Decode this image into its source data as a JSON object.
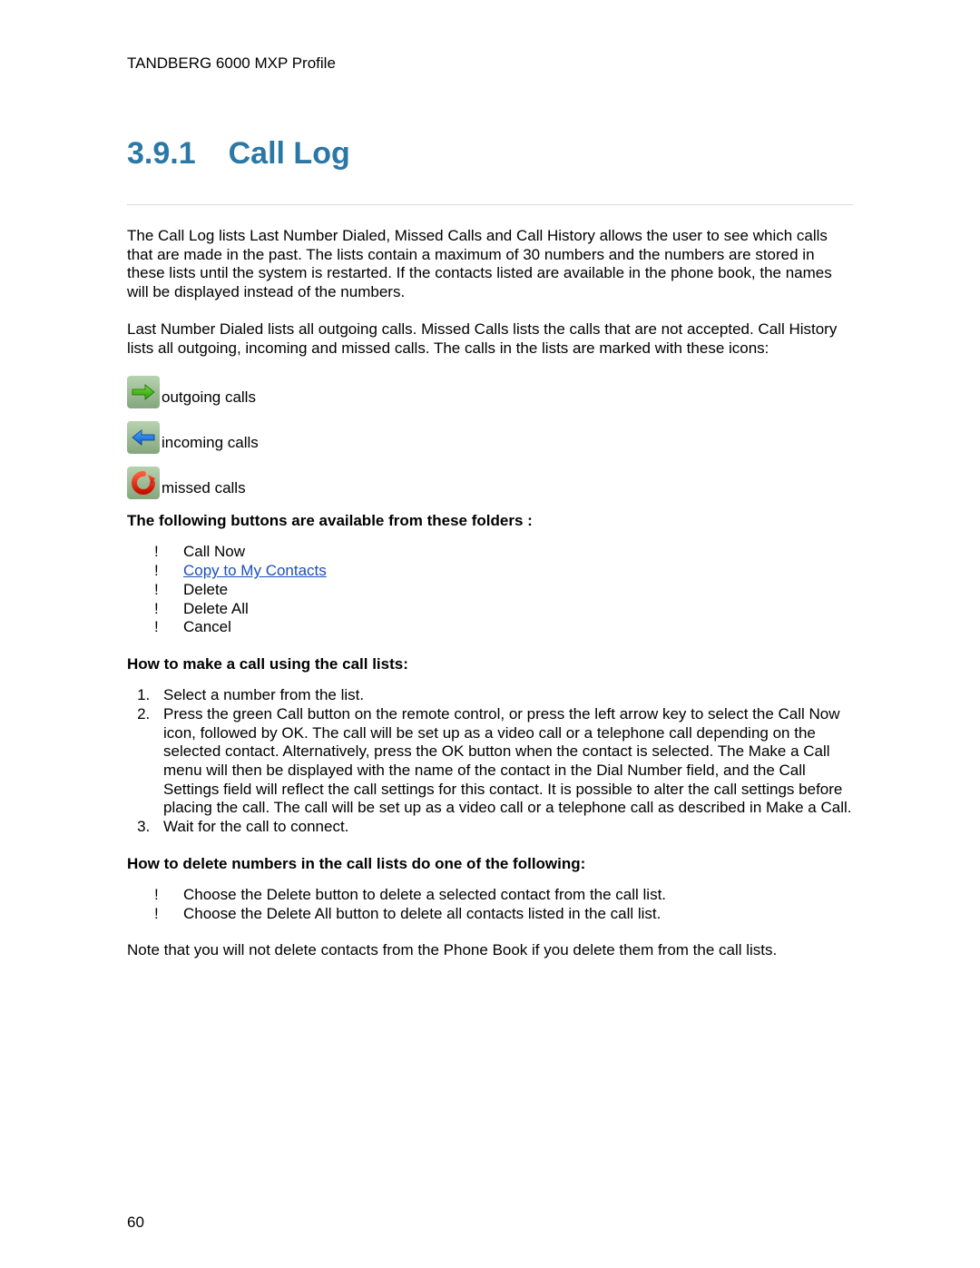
{
  "header": "TANDBERG 6000 MXP Profile",
  "section_number": "3.9.1",
  "section_title": "Call Log",
  "para1": "The Call Log lists Last Number Dialed, Missed Calls and Call History allows the user to see which calls that are made in the past. The lists contain a maximum of 30 numbers and the numbers are stored in these lists until the system is restarted. If the contacts listed are available in the phone book, the names will be displayed instead of the numbers.",
  "para2": "Last Number Dialed lists all outgoing calls. Missed Calls lists the calls that are not accepted. Call History lists all outgoing, incoming and missed calls. The calls in the lists are marked with these icons:",
  "icons": {
    "outgoing": "outgoing calls",
    "incoming": "incoming calls",
    "missed": "missed calls"
  },
  "sub1": "The following buttons are available from these folders :",
  "buttons": {
    "b0": "Call Now",
    "b1": "Copy to My Contacts",
    "b2": "Delete",
    "b3": "Delete All",
    "b4": "Cancel"
  },
  "sub2": "How to make a call using the call lists:",
  "steps": {
    "s0": "Select a number from the list.",
    "s1": "Press the green Call button on the remote control, or press the left arrow key to select the Call Now icon, followed by OK. The call will be set up as a video call or a telephone call depending on the selected contact. Alternatively, press the OK button when the contact is selected. The Make a Call menu will then be displayed with the name of the contact in the Dial Number field, and the Call Settings field will reflect the call settings for this contact. It is possible to alter the call settings before placing the call. The call will be set up as a video call or a telephone call as described in Make a Call.",
    "s2": "Wait for the call to connect."
  },
  "sub3": "How to delete numbers in the call lists do one of the following:",
  "delete_opts": {
    "d0": "Choose the Delete button to delete a selected contact from the call list.",
    "d1": "Choose the Delete All button to delete all contacts listed in the call list."
  },
  "note": "Note that you will not delete contacts from the Phone Book if you delete them from the call lists.",
  "page_number": "60"
}
